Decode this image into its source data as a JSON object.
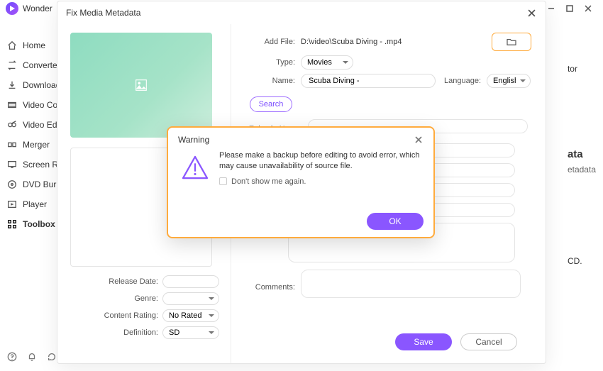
{
  "app_name": "Wonder",
  "sidebar": {
    "items": [
      {
        "label": "Home"
      },
      {
        "label": "Converter"
      },
      {
        "label": "Download"
      },
      {
        "label": "Video Compressor"
      },
      {
        "label": "Video Editor"
      },
      {
        "label": "Merger"
      },
      {
        "label": "Screen Recorder"
      },
      {
        "label": "DVD Burner"
      },
      {
        "label": "Player"
      },
      {
        "label": "Toolbox"
      }
    ]
  },
  "right_slice": {
    "suffix": "tor",
    "heading": "ata",
    "label2": "etadata",
    "cd": "CD."
  },
  "fix": {
    "title": "Fix Media Metadata",
    "add_file_label": "Add File:",
    "add_file_value": "D:\\video\\Scuba Diving - .mp4",
    "type_label": "Type:",
    "type_value": "Movies",
    "name_label": "Name:",
    "name_value": "Scuba Diving -",
    "language_label": "Language:",
    "language_value": "English",
    "search_label": "Search",
    "episode_label": "Episode Name:",
    "comments_label": "Comments:",
    "left_form": {
      "release_date_label": "Release Date:",
      "genre_label": "Genre:",
      "content_rating_label": "Content Rating:",
      "content_rating_value": "No Rated",
      "definition_label": "Definition:",
      "definition_value": "SD"
    },
    "save_label": "Save",
    "cancel_label": "Cancel"
  },
  "warning": {
    "title": "Warning",
    "body": "Please make a backup before editing to avoid error, which may cause unavailability of source file.",
    "dont_show": "Don't show me again.",
    "ok": "OK"
  }
}
